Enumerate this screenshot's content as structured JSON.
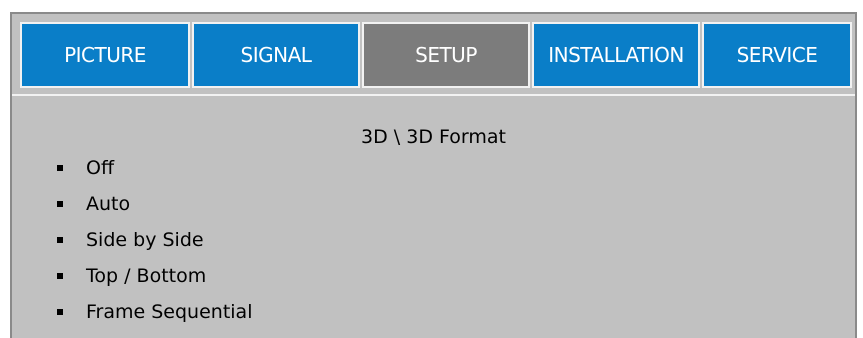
{
  "menu": {
    "tabs": [
      {
        "label": "PICTURE"
      },
      {
        "label": "SIGNAL"
      },
      {
        "label": "SETUP"
      },
      {
        "label": "INSTALLATION"
      },
      {
        "label": "SERVICE"
      }
    ],
    "active_tab": "SETUP",
    "title": "3D \\ 3D Format",
    "options": [
      {
        "label": "Off"
      },
      {
        "label": "Auto"
      },
      {
        "label": "Side by Side"
      },
      {
        "label": "Top / Bottom"
      },
      {
        "label": "Frame Sequential"
      }
    ]
  },
  "colors": {
    "tab_blue": "#0a7ec8",
    "tab_active_gray": "#7c7c7c",
    "panel_gray": "#c1c1c1"
  }
}
